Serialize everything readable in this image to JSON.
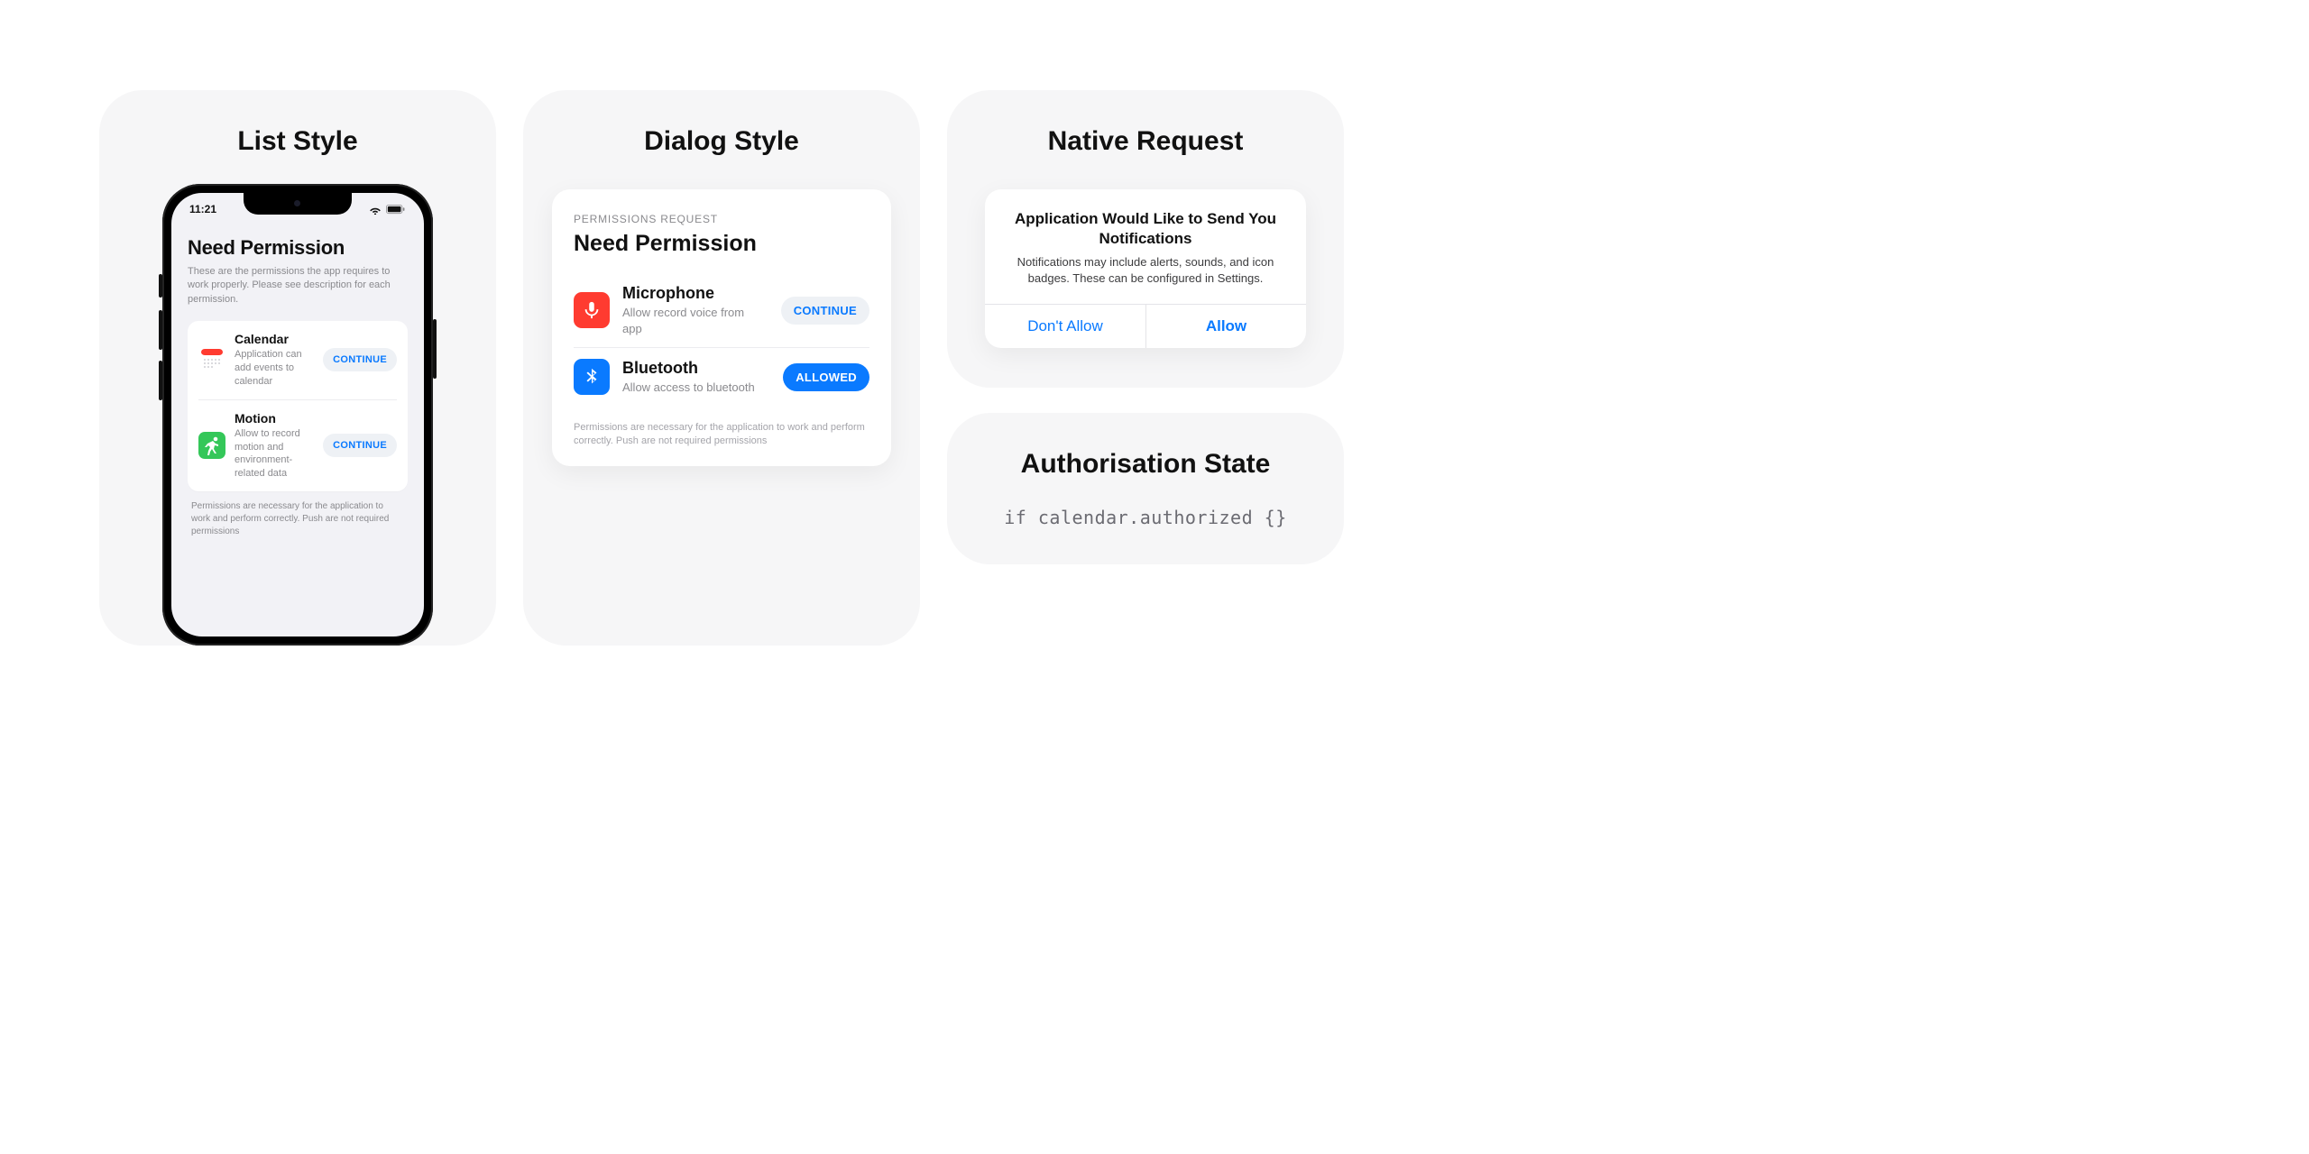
{
  "colors": {
    "accent": "#0a7aff",
    "red": "#ff3b30",
    "green": "#34c759",
    "panel_bg": "#f6f6f7",
    "muted": "#8a8a8e"
  },
  "panel1": {
    "title": "List Style",
    "statusbar": {
      "time": "11:21"
    },
    "heading": "Need Permission",
    "subheading": "These are the permissions the app requires to work properly. Please see description for each permission.",
    "items": [
      {
        "icon": "calendar-icon",
        "title": "Calendar",
        "desc": "Application can add events to calendar",
        "button": "CONTINUE"
      },
      {
        "icon": "motion-icon",
        "title": "Motion",
        "desc": "Allow to record motion and environment-related data",
        "button": "CONTINUE"
      }
    ],
    "footer": "Permissions are necessary for the application to work and perform correctly. Push are not required permissions"
  },
  "panel2": {
    "title": "Dialog Style",
    "eyebrow": "PERMISSIONS REQUEST",
    "heading": "Need Permission",
    "items": [
      {
        "icon": "microphone-icon",
        "color": "red",
        "title": "Microphone",
        "desc": "Allow record voice from app",
        "button": "CONTINUE",
        "state": "ghost"
      },
      {
        "icon": "bluetooth-icon",
        "color": "blue",
        "title": "Bluetooth",
        "desc": "Allow access to bluetooth",
        "button": "ALLOWED",
        "state": "solid"
      }
    ],
    "footer": "Permissions are necessary for the application to work and perform correctly. Push are not required permissions"
  },
  "panel3": {
    "title": "Native Request",
    "alert": {
      "title": "Application Would Like to Send You Notifications",
      "body": "Notifications may include alerts, sounds, and icon badges. These can be configured in Settings.",
      "deny": "Don't Allow",
      "allow": "Allow"
    }
  },
  "panel4": {
    "title": "Authorisation State",
    "code": "if calendar.authorized {}"
  }
}
